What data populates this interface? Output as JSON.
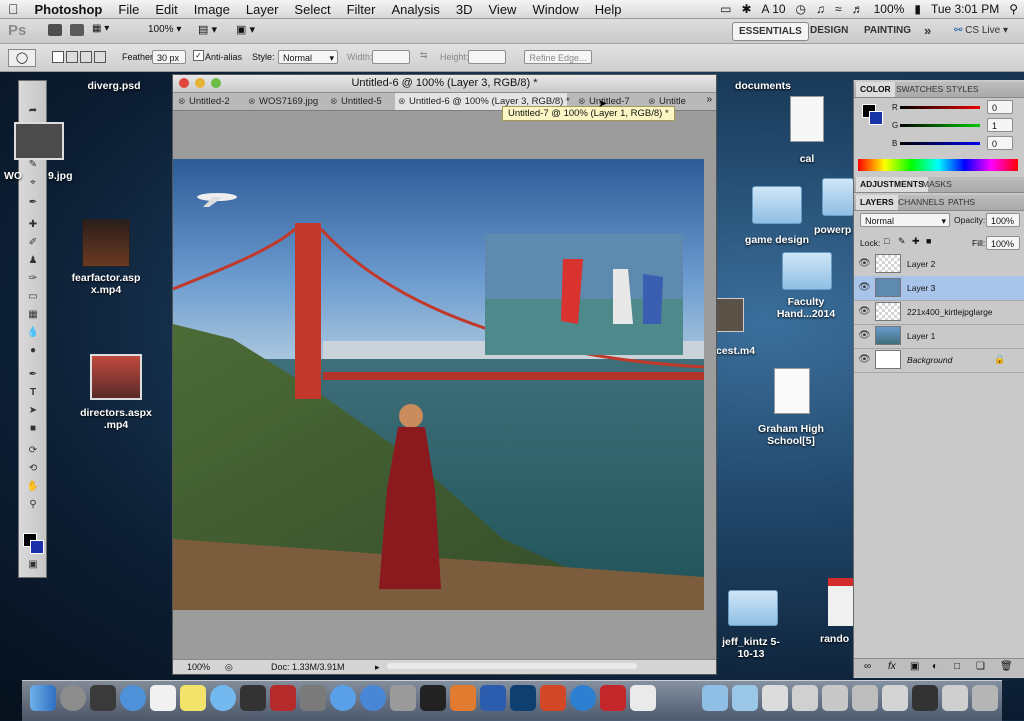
{
  "menubar": {
    "apple": "",
    "app_name": "Photoshop",
    "menus": [
      "File",
      "Edit",
      "Image",
      "Layer",
      "Select",
      "Filter",
      "Analysis",
      "3D",
      "View",
      "Window",
      "Help"
    ],
    "status": {
      "a10": "A 10",
      "battery": "100%",
      "time": "Tue 3:01 PM"
    }
  },
  "appbar": {
    "logo": "Ps",
    "zoom": "100%",
    "workspaces": [
      "ESSENTIALS",
      "DESIGN",
      "PAINTING"
    ],
    "more": "»",
    "cslive": "CS Live"
  },
  "options": {
    "feather_label": "Feather:",
    "feather_value": "30 px",
    "antialias_label": "Anti-alias",
    "style_label": "Style:",
    "style_value": "Normal",
    "width_label": "Width:",
    "height_label": "Height:",
    "refine_edge": "Refine Edge..."
  },
  "desktop": {
    "icons": [
      "diverg.psd",
      "WO",
      "9.jpg",
      "fearfactor.asp x.mp4",
      "directors.aspx .mp4",
      "documents",
      "cal",
      "game design",
      "powerp",
      "Faculty Hand...2014",
      "cest.m4",
      "Graham High School[5]",
      "jeff_kintz 5-10-13",
      "rando"
    ]
  },
  "document": {
    "title": "Untitled-6 @ 100% (Layer 3, RGB/8) *",
    "tabs": [
      "Untitled-2",
      "WOS7169.jpg",
      "Untitled-5",
      "Untitled-6 @ 100% (Layer 3, RGB/8) *",
      "Untitled-7",
      "Untitle"
    ],
    "tooltip": "Untitled-7 @ 100% (Layer 1, RGB/8) *",
    "status_zoom": "100%",
    "status_doc": "Doc: 1.33M/3.91M"
  },
  "panels": {
    "color_tabs": [
      "COLOR",
      "SWATCHES",
      "STYLES"
    ],
    "color_values": {
      "r": "0",
      "g": "1",
      "b": "0"
    },
    "adj_tabs": [
      "ADJUSTMENTS",
      "MASKS"
    ],
    "layer_tabs": [
      "LAYERS",
      "CHANNELS",
      "PATHS"
    ],
    "blend_mode": "Normal",
    "opacity_label": "Opacity:",
    "opacity_value": "100%",
    "lock_label": "Lock:",
    "fill_label": "Fill:",
    "fill_value": "100%",
    "layers": [
      "Layer 2",
      "Layer 3",
      "221x400_kirtlejpglarge",
      "Layer 1",
      "Background"
    ]
  },
  "colors": {
    "accent": "#a9c4ea",
    "layer_selected": "#a9c4ea"
  }
}
